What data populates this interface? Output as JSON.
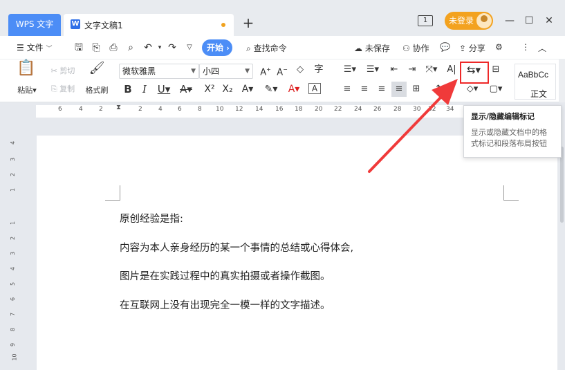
{
  "titlebar": {
    "app_tab": "WPS 文字",
    "doc_tab": "文字文稿1",
    "doc_icon": "W",
    "new_tab": "+",
    "page_count_icon": "1",
    "login": "未登录"
  },
  "menu": {
    "file": "文件",
    "start": "开始",
    "search": "查找命令",
    "unsaved": "未保存",
    "collaborate": "协作",
    "share": "分享"
  },
  "ribbon": {
    "paste": "粘贴",
    "cut": "剪切",
    "copy": "复制",
    "format_painter": "格式刷",
    "font_name": "微软雅黑",
    "font_size": "小四",
    "style_sample": "AaBbCc",
    "style_name": "正文"
  },
  "ruler": {
    "h_ticks": [
      "6",
      "4",
      "2",
      "2",
      "4",
      "6",
      "8",
      "10",
      "12",
      "14",
      "16",
      "18",
      "20",
      "22",
      "24",
      "26",
      "28",
      "30",
      "32",
      "34"
    ],
    "v_ticks": [
      "4",
      "3",
      "2",
      "1",
      "1",
      "2",
      "3",
      "4",
      "5",
      "6",
      "7",
      "8",
      "9",
      "10",
      "11"
    ]
  },
  "tooltip": {
    "title": "显示/隐藏编辑标记",
    "description": "显示或隐藏文档中的格式标记和段落布局按钮"
  },
  "document": {
    "paragraphs": [
      "原创经验是指:",
      "内容为本人亲身经历的某一个事情的总结或心得体会,",
      "图片是在实践过程中的真实拍摄或者操作截图。",
      "在互联网上没有出现完全一模一样的文字描述。"
    ]
  },
  "colors": {
    "accent": "#4c8df6",
    "login_pill": "#f3a21f",
    "highlight_box": "#ee2828",
    "arrow": "#f03a3a"
  }
}
